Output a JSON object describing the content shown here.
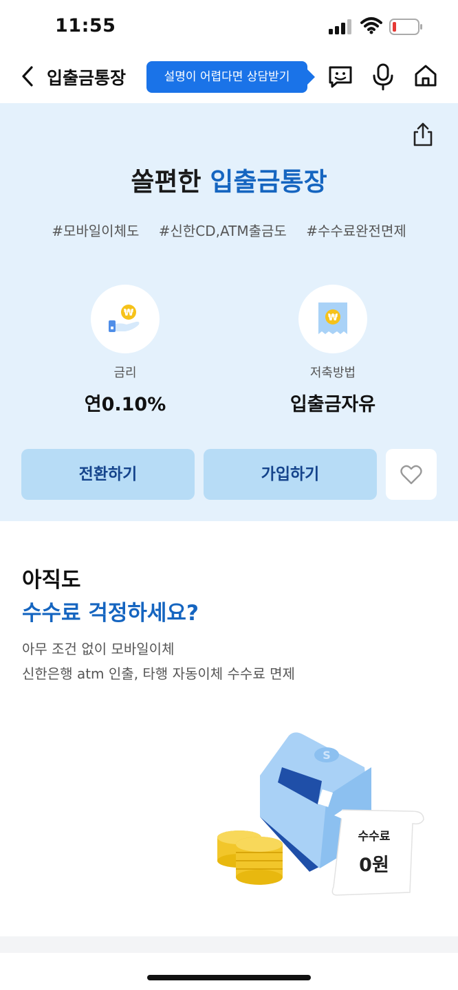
{
  "status": {
    "time": "11:55"
  },
  "nav": {
    "title": "입출금통장",
    "consult_label": "설명이 어렵다면 상담받기"
  },
  "hero": {
    "title_part1": "쏠편한",
    "title_accent": "입출금통장",
    "tags": [
      "#모바일이체도",
      "#신한CD,ATM출금도",
      "#수수료완전면제"
    ],
    "features": [
      {
        "icon": "hand-coin-icon",
        "label": "금리",
        "value": "연0.10%"
      },
      {
        "icon": "receipt-won-icon",
        "label": "저축방법",
        "value": "입출금자유"
      }
    ],
    "buttons": {
      "convert": "전환하기",
      "join": "가입하기"
    }
  },
  "section2": {
    "line1": "아직도",
    "line2": "수수료 걱정하세요?",
    "desc1": "아무 조건 없이 모바일이체",
    "desc2": "신한은행 atm 인출, 타행 자동이체 수수료 면제",
    "receipt_label": "수수료",
    "receipt_value": "0원"
  },
  "colors": {
    "accent": "#1565c0",
    "hero_bg": "#e4f1fc",
    "button_bg": "#b7dcf6",
    "consult_bg": "#1a73e8"
  }
}
